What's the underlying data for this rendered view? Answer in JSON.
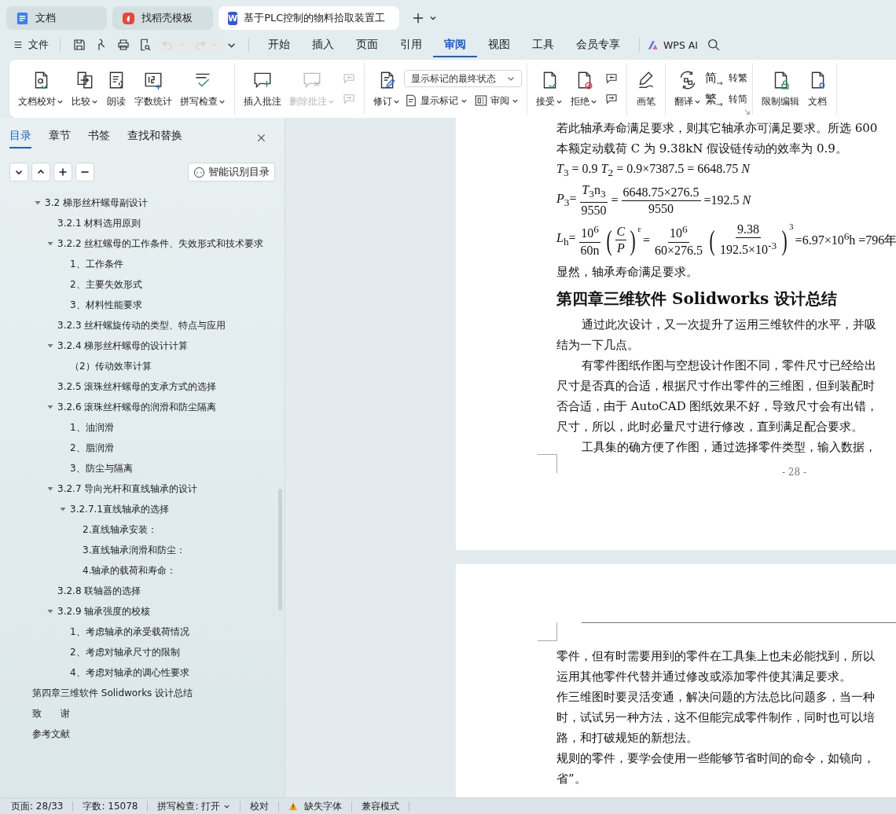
{
  "browser_tabs": [
    {
      "kind": "docs",
      "label": "文档",
      "selected": false
    },
    {
      "kind": "template",
      "label": "找稻壳模板",
      "selected": false
    },
    {
      "kind": "writer",
      "label": "基于PLC控制的物料拾取装置工",
      "logo_letter": "W",
      "selected": true
    }
  ],
  "menu": {
    "file_label": "文件",
    "quick_access": [
      {
        "disabled": false,
        "dropdown": false
      },
      {
        "disabled": false,
        "dropdown": false
      },
      {
        "disabled": false,
        "dropdown": false
      },
      {
        "disabled": false,
        "dropdown": false
      },
      {
        "disabled": true,
        "dropdown": true
      },
      {
        "disabled": true,
        "dropdown": true
      }
    ],
    "tabs": [
      {
        "label": "开始",
        "selected": false
      },
      {
        "label": "插入",
        "selected": false
      },
      {
        "label": "页面",
        "selected": false
      },
      {
        "label": "引用",
        "selected": false
      },
      {
        "label": "审阅",
        "selected": true
      },
      {
        "label": "视图",
        "selected": false
      },
      {
        "label": "工具",
        "selected": false
      },
      {
        "label": "会员专享",
        "selected": false
      }
    ],
    "ai_label": "WPS AI"
  },
  "ribbon": {
    "groups": [
      {
        "launcher": false,
        "columns": [
          [
            [
              {
                "kind": "large",
                "label": "文档校对",
                "dropdown": true,
                "disabled": false
              }
            ]
          ],
          [
            [
              {
                "kind": "large",
                "label": "比较",
                "dropdown": true,
                "disabled": false
              }
            ]
          ],
          [
            [
              {
                "kind": "large",
                "label": "朗读",
                "dropdown": false,
                "disabled": false
              }
            ]
          ],
          [
            [
              {
                "kind": "large",
                "label": "字数统计",
                "dropdown": false,
                "disabled": false
              }
            ]
          ],
          [
            [
              {
                "kind": "large",
                "label": "拼写检查",
                "dropdown": true,
                "disabled": false
              }
            ]
          ]
        ]
      },
      {
        "launcher": false,
        "columns": [
          [
            [
              {
                "kind": "large",
                "label": "插入批注",
                "dropdown": false,
                "disabled": false
              }
            ]
          ],
          [
            [
              {
                "kind": "large",
                "label": "删除批注",
                "dropdown": true,
                "disabled": true
              }
            ]
          ],
          [
            [
              {
                "kind": "small",
                "disabled": true
              }
            ],
            [
              {
                "kind": "small",
                "disabled": true
              }
            ]
          ]
        ]
      },
      {
        "launcher": false,
        "columns": [
          [
            [
              {
                "kind": "large",
                "label": "修订",
                "dropdown": true,
                "disabled": false
              }
            ]
          ],
          [
            [
              {
                "kind": "select",
                "value": "显示标记的最终状态"
              }
            ],
            [
              {
                "kind": "row",
                "label": "显示标记",
                "dropdown": true,
                "disabled": false
              },
              {
                "kind": "row",
                "label": "审阅",
                "dropdown": true,
                "disabled": false
              }
            ]
          ]
        ]
      },
      {
        "launcher": false,
        "columns": [
          [
            [
              {
                "kind": "large",
                "label": "接受",
                "dropdown": true,
                "disabled": false
              }
            ]
          ],
          [
            [
              {
                "kind": "large",
                "label": "拒绝",
                "dropdown": true,
                "disabled": false
              }
            ]
          ],
          [
            [
              {
                "kind": "small",
                "disabled": false
              }
            ],
            [
              {
                "kind": "small",
                "disabled": false
              }
            ]
          ]
        ]
      },
      {
        "launcher": false,
        "columns": [
          [
            [
              {
                "kind": "large",
                "label": "画笔",
                "dropdown": false,
                "disabled": false
              }
            ]
          ]
        ]
      },
      {
        "launcher": true,
        "columns": [
          [
            [
              {
                "kind": "large",
                "label": "翻译",
                "dropdown": true,
                "disabled": false
              }
            ]
          ],
          [
            [
              {
                "kind": "row",
                "glyph": "简",
                "label": "转繁",
                "dropdown": false,
                "disabled": false
              }
            ],
            [
              {
                "kind": "row",
                "glyph": "繁",
                "label": "转简",
                "dropdown": false,
                "disabled": false
              }
            ]
          ]
        ]
      },
      {
        "launcher": false,
        "columns": [
          [
            [
              {
                "kind": "large",
                "label": "限制编辑",
                "dropdown": false,
                "disabled": false
              }
            ]
          ],
          [
            [
              {
                "kind": "large",
                "label": "文档",
                "dropdown": false,
                "disabled": false
              }
            ]
          ]
        ]
      }
    ]
  },
  "sidebar": {
    "tabs": [
      {
        "label": "目录",
        "selected": true
      },
      {
        "label": "章节",
        "selected": false
      },
      {
        "label": "书签",
        "selected": false
      },
      {
        "label": "查找和替换",
        "selected": false
      }
    ],
    "smart_button": "智能识别目录",
    "toc": {
      "continued_items": [
        {
          "title": "3.2 梯形丝杆螺母副设计",
          "expanded": true,
          "children": [
            {
              "title": "3.2.1 材料选用原则"
            },
            {
              "title": "3.2.2 丝杠螺母的工作条件、失效形式和技术要求",
              "expanded": true,
              "children": [
                {
                  "title": "1、工作条件"
                },
                {
                  "title": "2、主要失效形式"
                },
                {
                  "title": "3、材料性能要求"
                }
              ]
            },
            {
              "title": "3.2.3 丝杆螺旋传动的类型、特点与应用"
            },
            {
              "title": "3.2.4 梯形丝杆螺母的设计计算",
              "expanded": true,
              "children": [
                {
                  "title": "（2）传动效率计算"
                }
              ]
            },
            {
              "title": "3.2.5 滚珠丝杆螺母的支承方式的选择"
            },
            {
              "title": "3.2.6 滚珠丝杆螺母的润滑和防尘隔离",
              "expanded": true,
              "children": [
                {
                  "title": "1、油润滑"
                },
                {
                  "title": "2、脂润滑"
                },
                {
                  "title": "3、防尘与隔离"
                }
              ]
            },
            {
              "title": "3.2.7 导向光杆和直线轴承的设计",
              "expanded": true,
              "children": [
                {
                  "title": "3.2.7.1直线轴承的选择",
                  "expanded": true,
                  "children": [
                    {
                      "title": "2.直线轴承安装："
                    },
                    {
                      "title": "3.直线轴承润滑和防尘："
                    },
                    {
                      "title": "4.轴承的载荷和寿命："
                    }
                  ]
                }
              ]
            },
            {
              "title": "3.2.8 联轴器的选择"
            },
            {
              "title": "3.2.9 轴承强度的校核",
              "expanded": true,
              "children": [
                {
                  "title": "1、考虑轴承的承受载荷情况"
                },
                {
                  "title": "2、考虑对轴承尺寸的限制"
                },
                {
                  "title": "4、考虑对轴承的调心性要求"
                }
              ]
            }
          ]
        }
      ],
      "items": [
        {
          "title": "第四章三维软件 Solidworks 设计总结"
        },
        {
          "title": "致　　谢"
        },
        {
          "title": "参考文献"
        }
      ]
    }
  },
  "document": {
    "pages": [
      {
        "page_number": "- 28 -",
        "blocks": [
          {
            "kind": "paragraph",
            "indent": false,
            "lines": [
              "若此轴承寿命满足要求，则其它轴承亦可满足要求。所选 600",
              "本额定动载荷 C 为 9.38kN 假设链传动的效率为 0.9。"
            ]
          },
          {
            "kind": "formula",
            "tokens": [
              {
                "kind": "text",
                "text": "*T*$_{3}$ = 0.9 *T*$_{2}$ = 0.9×7387.5 = 6648.75 *N*"
              }
            ]
          },
          {
            "kind": "formula",
            "tokens": [
              {
                "kind": "text",
                "text": "*P*$_{3}$="
              },
              {
                "kind": "frac",
                "num": "*T*$_{3}$n$_{3}$",
                "den": "9550"
              },
              {
                "kind": "text",
                "text": "="
              },
              {
                "kind": "frac",
                "num": "6648.75×276.5",
                "den": "9550"
              },
              {
                "kind": "text",
                "text": "=192.5 *N*"
              }
            ]
          },
          {
            "kind": "formula",
            "tokens": [
              {
                "kind": "text",
                "text": "*L*$_{h}$="
              },
              {
                "kind": "frac",
                "num": "10$^{6}$",
                "den": "60n"
              },
              {
                "kind": "group",
                "open": "(",
                "close": ")",
                "power": "ε",
                "items": [
                  {
                    "kind": "frac",
                    "num": "*C*",
                    "den": "*P*"
                  }
                ]
              },
              {
                "kind": "text",
                "text": "="
              },
              {
                "kind": "frac",
                "num": "10$^{6}$",
                "den": "60×276.5"
              },
              {
                "kind": "group",
                "open": "(",
                "close": ")",
                "power": "3",
                "items": [
                  {
                    "kind": "frac",
                    "num": "9.38",
                    "den": "192.5×10$^{-3}$"
                  }
                ]
              },
              {
                "kind": "text",
                "text": "=6.97×10$^{6}$h =796年"
              }
            ]
          },
          {
            "kind": "paragraph",
            "indent": false,
            "lines": [
              "显然，轴承寿命满足要求。"
            ]
          },
          {
            "kind": "heading",
            "text": "第四章三维软件 Solidworks 设计总结"
          },
          {
            "kind": "paragraph",
            "indent": true,
            "lines": [
              "通过此次设计，又一次提升了运用三维软件的水平，并吸",
              "结为一下几点。"
            ]
          },
          {
            "kind": "paragraph",
            "indent": true,
            "lines": [
              "有零件图纸作图与空想设计作图不同，零件尺寸已经给出",
              "尺寸是否真的合适，根据尺寸作出零件的三维图，但到装配时",
              "否合适，由于 AutoCAD 图纸效果不好，导致尺寸会有出错，",
              "尺寸，所以，此时必量尺寸进行修改，直到满足配合要求。"
            ]
          },
          {
            "kind": "paragraph",
            "indent": true,
            "lines": [
              "工具集的确方便了作图，通过选择零件类型，输入数据，"
            ]
          }
        ]
      },
      {
        "blocks": [
          {
            "kind": "paragraph",
            "indent": false,
            "lines": [
              "零件，但有时需要用到的零件在工具集上也未必能找到，所以",
              "运用其他零件代替并通过修改或添加零件使其满足要求。"
            ]
          },
          {
            "kind": "paragraph",
            "indent": false,
            "lines": [
              "作三维图时要灵活变通，解决问题的方法总比问题多，当一种",
              "时，试试另一种方法，这不但能完成零件制作，同时也可以培",
              "路，和打破规矩的新想法。"
            ]
          },
          {
            "kind": "paragraph",
            "indent": false,
            "lines": [
              "规则的零件，要学会使用一些能够节省时间的命令，如镜向，",
              "省”。"
            ]
          }
        ]
      }
    ]
  },
  "status_bar": [
    {
      "text": "页面: 28/33"
    },
    {
      "text": "字数: 15078"
    },
    {
      "text": "拼写检查: 打开",
      "dropdown": true
    },
    {
      "text": "校对"
    },
    {
      "text": "缺失字体",
      "warning": true
    },
    {
      "text": "兼容模式"
    }
  ]
}
